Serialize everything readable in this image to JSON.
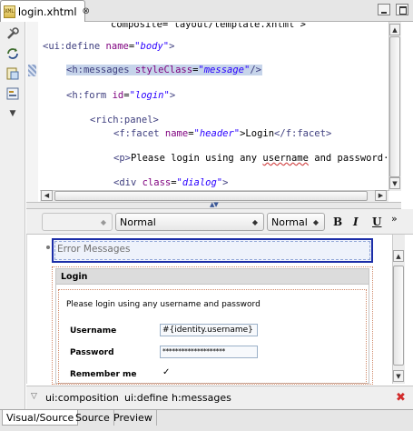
{
  "editor_tab": {
    "title": "login.xhtml",
    "icon_label": "XML",
    "close": "⊗"
  },
  "toolbar_icons": [
    "wrench-icon",
    "refresh-icon",
    "preview-icon",
    "palette-icon",
    "chevron-down-icon"
  ],
  "source": {
    "top_cut_line": "composite=\"layout/template.xhtml\">",
    "line1": {
      "open": "<ui:define ",
      "attr": "name",
      "eq": "=",
      "val": "\"body\"",
      "close": ">"
    },
    "line2": {
      "open": "<h:messages ",
      "attr": "styleClass",
      "eq": "=",
      "val": "\"message\"",
      "close": "/>"
    },
    "line3": {
      "open": "<h:form ",
      "attr": "id",
      "eq": "=",
      "val": "\"login\"",
      "close": ">"
    },
    "line4": {
      "tag": "<rich:panel>"
    },
    "line5": {
      "open": "<f:facet ",
      "attr": "name",
      "eq": "=",
      "val": "\"header\"",
      "mid": ">Login",
      "close": "</f:facet>"
    },
    "line6": {
      "tag": "<p>",
      "text_before": "Please login using any ",
      "squiggle": "username",
      "text_after": " and password·"
    },
    "line7": {
      "open": "<div ",
      "attr": "class",
      "eq": "=",
      "val": "\"dialog\"",
      "close": ">"
    }
  },
  "format_toolbar": {
    "style_combo": "",
    "format_combo": "Normal",
    "size_combo": "Normal",
    "bold": "B",
    "italic": "I",
    "underline": "U",
    "more": "»"
  },
  "visual": {
    "error_messages": "Error Messages",
    "panel_header": "Login",
    "intro": "Please login using any username and password",
    "username_label": "Username",
    "username_value": "#{identity.username}",
    "password_label": "Password",
    "password_value": "********************",
    "remember_label": "Remember me",
    "remember_check": "✓"
  },
  "breadcrumb": {
    "dropdown": "▽",
    "items": [
      "ui:composition",
      "ui:define",
      "h:messages"
    ],
    "close": "✖"
  },
  "bottom_tabs": [
    "Visual/Source",
    "Source",
    "Preview"
  ]
}
